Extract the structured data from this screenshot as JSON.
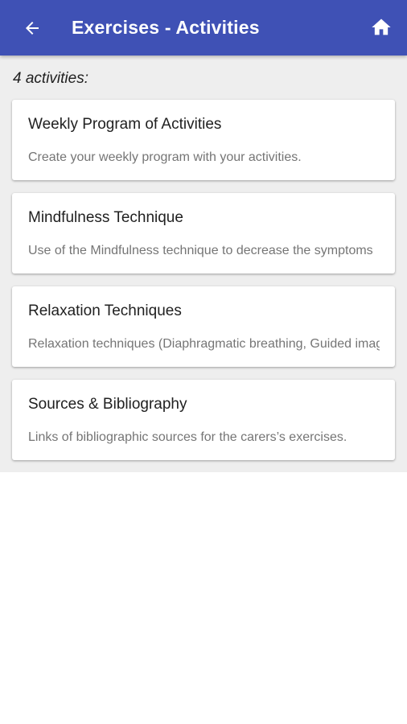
{
  "header": {
    "title": "Exercises - Activities",
    "back_icon": "arrow-back-icon",
    "home_icon": "home-icon",
    "color": "#3f51b5"
  },
  "main": {
    "count_label": "4 activities:",
    "cards": [
      {
        "title": "Weekly Program of Activities",
        "description": "Create your weekly program with your activities."
      },
      {
        "title": "Mindfulness Technique",
        "description": "Use of the Mindfulness technique to decrease the symptoms"
      },
      {
        "title": "Relaxation Techniques",
        "description": "Relaxation techniques (Diaphragmatic breathing, Guided imagery)"
      },
      {
        "title": "Sources & Bibliography",
        "description": "Links of bibliographic sources for the carers’s exercises."
      }
    ]
  }
}
